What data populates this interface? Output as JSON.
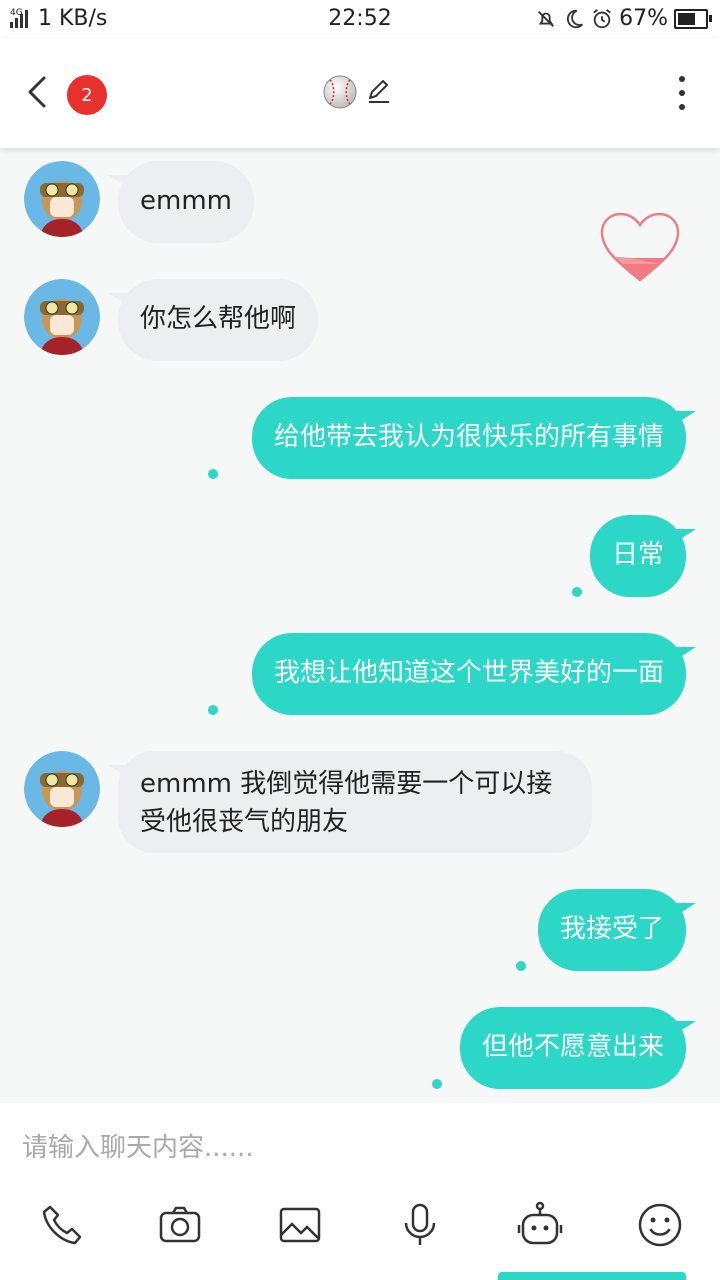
{
  "status_bar": {
    "network": "4G",
    "speed": "1 KB/s",
    "time": "22:52",
    "battery": "67%",
    "battery_level": 0.67
  },
  "header": {
    "unread_count": "2"
  },
  "messages": [
    {
      "side": "in",
      "text": "emmm"
    },
    {
      "side": "in",
      "text": "你怎么帮他啊"
    },
    {
      "side": "out",
      "text": "给他带去我认为很快乐的所有事情"
    },
    {
      "side": "out",
      "text": "日常"
    },
    {
      "side": "out",
      "text": "我想让他知道这个世界美好的一面"
    },
    {
      "side": "in",
      "text": "emmm 我倒觉得他需要一个可以接受他很丧气的朋友"
    },
    {
      "side": "out",
      "text": "我接受了"
    },
    {
      "side": "out",
      "text": "但他不愿意出来"
    }
  ],
  "input": {
    "placeholder": "请输入聊天内容......"
  },
  "icons": {
    "back": "back-arrow-icon",
    "ball": "baseball-icon",
    "edit": "pencil-icon",
    "more": "more-vertical-icon",
    "heart": "heart-icon",
    "phone": "phone-icon",
    "camera": "camera-icon",
    "image": "image-icon",
    "mic": "microphone-icon",
    "robot": "robot-icon",
    "emoji": "emoji-icon"
  },
  "colors": {
    "accent": "#2dd7c7",
    "badge": "#e8312c",
    "incoming_bubble": "#eceef0"
  }
}
